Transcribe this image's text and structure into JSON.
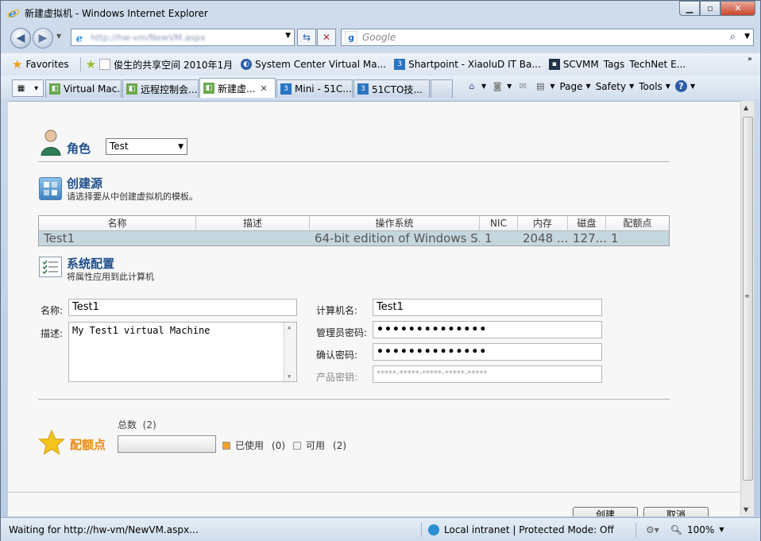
{
  "window": {
    "title": "新建虚拟机 - Windows Internet Explorer"
  },
  "address": {
    "url": "http://hw-vm/NewVM.aspx",
    "search_placeholder": "Google"
  },
  "favorites": {
    "label": "Favorites",
    "items": [
      {
        "label": "俊生的共享空间 2010年1月",
        "icon": "page-icon"
      },
      {
        "label": "System Center Virtual Ma...",
        "icon": "scvmm-icon"
      },
      {
        "label": "Shartpoint - XiaoluD IT Ba...",
        "icon": "51cto-icon"
      },
      {
        "label": "SCVMM",
        "icon": "monitor-icon"
      },
      {
        "label": "Tags",
        "icon": "none"
      },
      {
        "label": "TechNet E...",
        "icon": "none"
      }
    ]
  },
  "tabs": [
    {
      "label": "Virtual Mac...",
      "active": false
    },
    {
      "label": "远程控制会...",
      "active": false
    },
    {
      "label": "新建虚...",
      "active": true
    },
    {
      "label": "Mini - 51C...",
      "active": false
    },
    {
      "label": "51CTO技...",
      "active": false
    }
  ],
  "command_bar": {
    "page": "Page",
    "safety": "Safety",
    "tools": "Tools"
  },
  "role": {
    "label": "角色",
    "selected": "Test"
  },
  "source": {
    "title": "创建源",
    "subtitle": "请选择要从中创建虚拟机的模板。",
    "columns": [
      "名称",
      "描述",
      "操作系统",
      "NIC",
      "内存",
      "磁盘",
      "配额点"
    ],
    "rows": [
      [
        "Test1",
        "",
        "64-bit edition of Windows S...",
        "1",
        "2048 ...",
        "127...",
        "1"
      ]
    ]
  },
  "sysconfig": {
    "title": "系统配置",
    "subtitle": "将属性应用到此计算机",
    "name_label": "名称:",
    "name_value": "Test1",
    "desc_label": "描述:",
    "desc_value": "My Test1 virtual Machine",
    "computer_label": "计算机名:",
    "computer_value": "Test1",
    "admin_pw_label": "管理员密码:",
    "admin_pw_value": "••••••••••••••",
    "confirm_pw_label": "确认密码:",
    "confirm_pw_value": "••••••••••••••",
    "product_key_label": "产品密钥:",
    "product_key_placeholder": "*****-*****-*****-*****-*****"
  },
  "quota": {
    "title": "配额点",
    "total_label": "总数",
    "total_value": "(2)",
    "used_label": "已使用",
    "used_value": "(0)",
    "available_label": "可用",
    "available_value": "(2)",
    "used_color": "#f0a02c",
    "used_fraction": 0
  },
  "buttons": {
    "create": "创建",
    "cancel": "取消"
  },
  "status": {
    "text": "Waiting for http://hw-vm/NewVM.aspx...",
    "zone": "Local intranet | Protected Mode: Off",
    "zoom": "100%"
  }
}
